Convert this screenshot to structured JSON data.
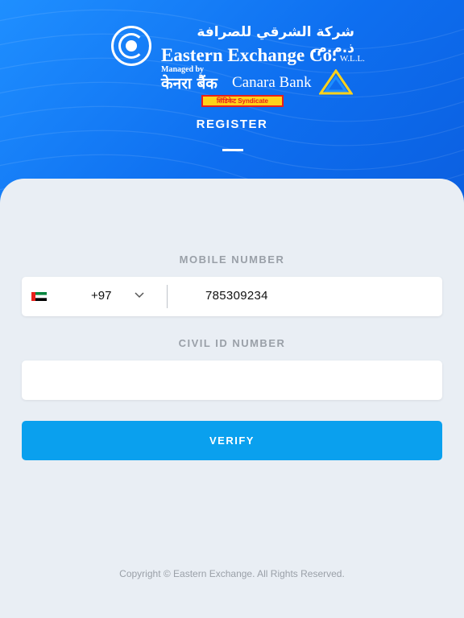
{
  "brand": {
    "arabic_name": "شركة الشرقي للصرافة ذ.م.م.",
    "english_name": "Eastern Exchange Co.",
    "english_suffix": "W.L.L.",
    "managed_by": "Managed by",
    "hindi_name": "केनरा बैंक",
    "canara_name": "Canara Bank",
    "syndicate_label": "सिंडिकेट Syndicate"
  },
  "page": {
    "title": "REGISTER"
  },
  "mobile": {
    "label": "MOBILE NUMBER",
    "country_code": "+97",
    "country_flag": "uae-flag-icon",
    "value": "785309234"
  },
  "civil_id": {
    "label": "CIVIL ID NUMBER",
    "value": ""
  },
  "actions": {
    "verify_label": "VERIFY"
  },
  "footer": {
    "copyright": "Copyright © Eastern Exchange. All Rights Reserved."
  },
  "colors": {
    "header_blue": "#0e6ff0",
    "button_blue": "#0aa0ee",
    "background": "#e9eef4",
    "label_gray": "#9aa0a8"
  }
}
